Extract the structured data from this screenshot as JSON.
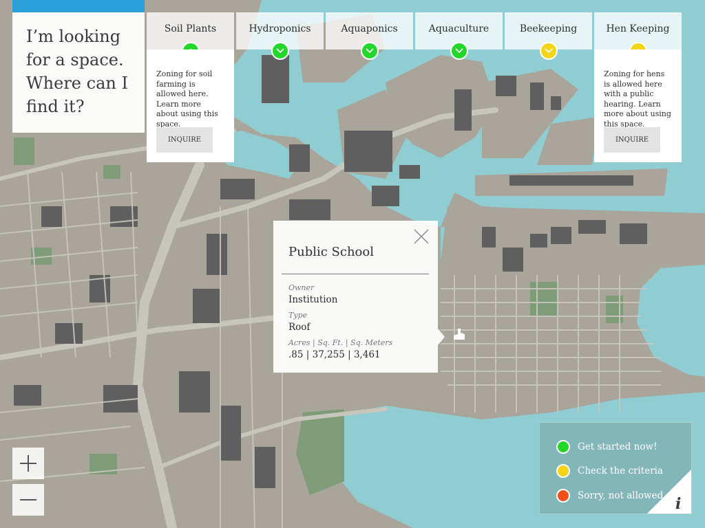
{
  "question": {
    "text": "I’m looking for a space. Where can I find it?"
  },
  "tabs": [
    {
      "label": "Soil Plants",
      "status": "green",
      "expanded": true
    },
    {
      "label": "Hydroponics",
      "status": "green",
      "expanded": false
    },
    {
      "label": "Aquaponics",
      "status": "green",
      "expanded": false
    },
    {
      "label": "Aquaculture",
      "status": "green",
      "expanded": false
    },
    {
      "label": "Beekeeping",
      "status": "yellow",
      "expanded": false
    },
    {
      "label": "Hen Keeping",
      "status": "yellow",
      "expanded": true
    }
  ],
  "cards": {
    "soil": {
      "text": "Zoning for soil farming is allowed here. Learn more about using this space.",
      "button": "INQUIRE"
    },
    "hen": {
      "text": "Zoning for hens is allowed here with a public hearing. Learn more about using this space.",
      "button": "INQUIRE"
    }
  },
  "popup": {
    "title": "Public School",
    "owner_label": "Owner",
    "owner": "Institution",
    "type_label": "Type",
    "type": "Roof",
    "size_label": "Acres | Sq. Ft. | Sq. Meters",
    "size": ".85 | 37,255 | 3,461"
  },
  "legend": {
    "green": "Get started now!",
    "yellow": "Check the criteria",
    "red": "Sorry, not allowed"
  },
  "colors": {
    "green": "#22d62a",
    "yellow": "#f4d416",
    "red": "#f2511b",
    "water": "#8fcdd3",
    "land": "#a9a59a",
    "building": "#5f5f5f",
    "park": "#7f9c78",
    "accent": "#2b9fd9"
  },
  "icons": {
    "close": "close-icon",
    "zoom_in": "plus-icon",
    "zoom_out": "minus-icon",
    "info": "info-icon",
    "marker": "school-marker-icon"
  }
}
